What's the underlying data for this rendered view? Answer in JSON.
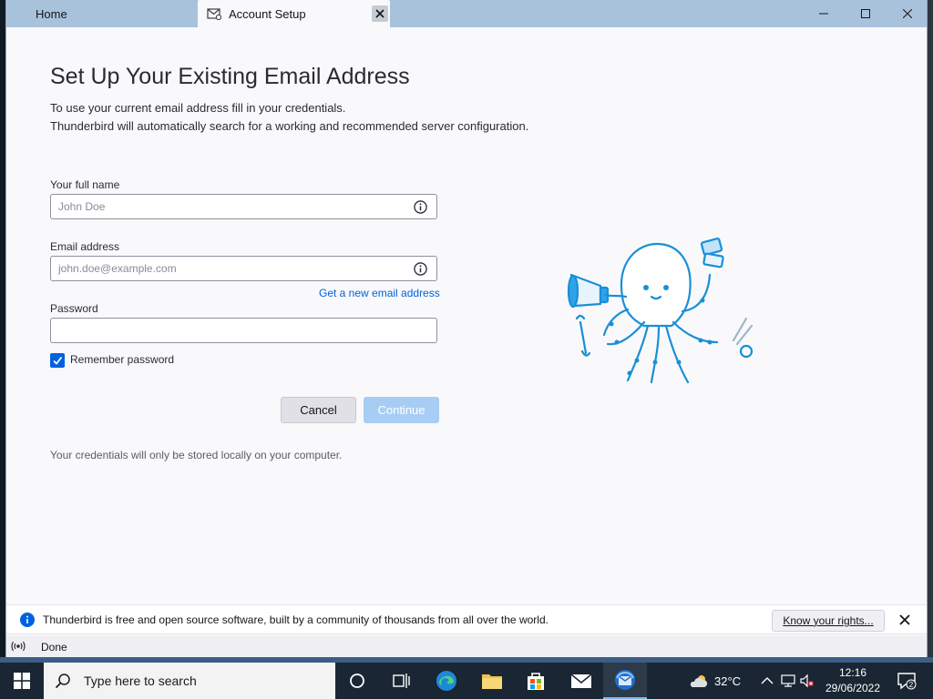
{
  "tabs": {
    "home": "Home",
    "account_setup": "Account Setup"
  },
  "setup": {
    "title": "Set Up Your Existing Email Address",
    "description_line1": "To use your current email address fill in your credentials.",
    "description_line2": "Thunderbird will automatically search for a working and recommended server configuration.",
    "full_name_label": "Your full name",
    "full_name_placeholder": "John Doe",
    "email_label": "Email address",
    "email_placeholder": "john.doe@example.com",
    "new_email_link": "Get a new email address",
    "password_label": "Password",
    "password_value": "",
    "remember_password_label": "Remember password",
    "remember_password_checked": true,
    "cancel_label": "Cancel",
    "continue_label": "Continue",
    "privacy_note": "Your credentials will only be stored locally on your computer."
  },
  "notification": {
    "text": "Thunderbird is free and open source software, built by a community of thousands from all over the world.",
    "button_label": "Know your rights..."
  },
  "status": {
    "text": "Done"
  },
  "taskbar": {
    "search_placeholder": "Type here to search",
    "temperature": "32°C",
    "time": "12:16",
    "date": "29/06/2022",
    "notification_count": "2"
  },
  "colors": {
    "accent": "#0061e0",
    "titlebar": "#a9c2dc",
    "continue_disabled": "#a8cdf5",
    "taskbar": "#1a2633"
  }
}
